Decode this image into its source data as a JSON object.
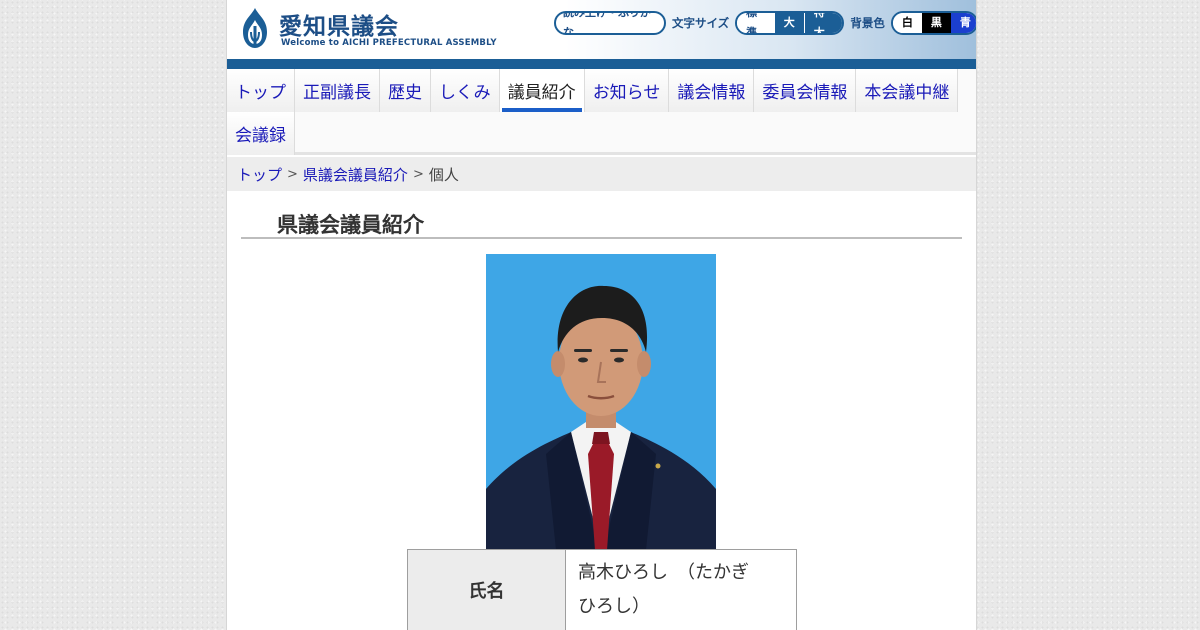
{
  "header": {
    "title": "愛知県議会",
    "subtitle": "Welcome to AICHI PREFECTURAL ASSEMBLY",
    "read_aloud_label": "読み上げ・ふりがな",
    "font_size_label": "文字サイズ",
    "font_sizes": [
      "標準",
      "大",
      "特大"
    ],
    "bg_color_label": "背景色",
    "bg_colors": [
      "白",
      "黒",
      "青"
    ]
  },
  "nav": {
    "items": [
      "トップ",
      "正副議長",
      "歴史",
      "しくみ",
      "議員紹介",
      "お知らせ",
      "議会情報",
      "委員会情報",
      "本会議中継",
      "会議録"
    ],
    "active_index": 4
  },
  "breadcrumb": {
    "items": [
      "トップ",
      "県議会議員紹介",
      "個人"
    ],
    "separator": ">"
  },
  "main": {
    "heading": "県議会議員紹介",
    "profile": {
      "name_label": "氏名",
      "name_value": "高木ひろし　（たかぎ　ひろし）"
    }
  },
  "colors": {
    "brand_blue": "#1b5e96",
    "link": "#1a1ab8",
    "photo_bg": "#3ea6e6"
  }
}
